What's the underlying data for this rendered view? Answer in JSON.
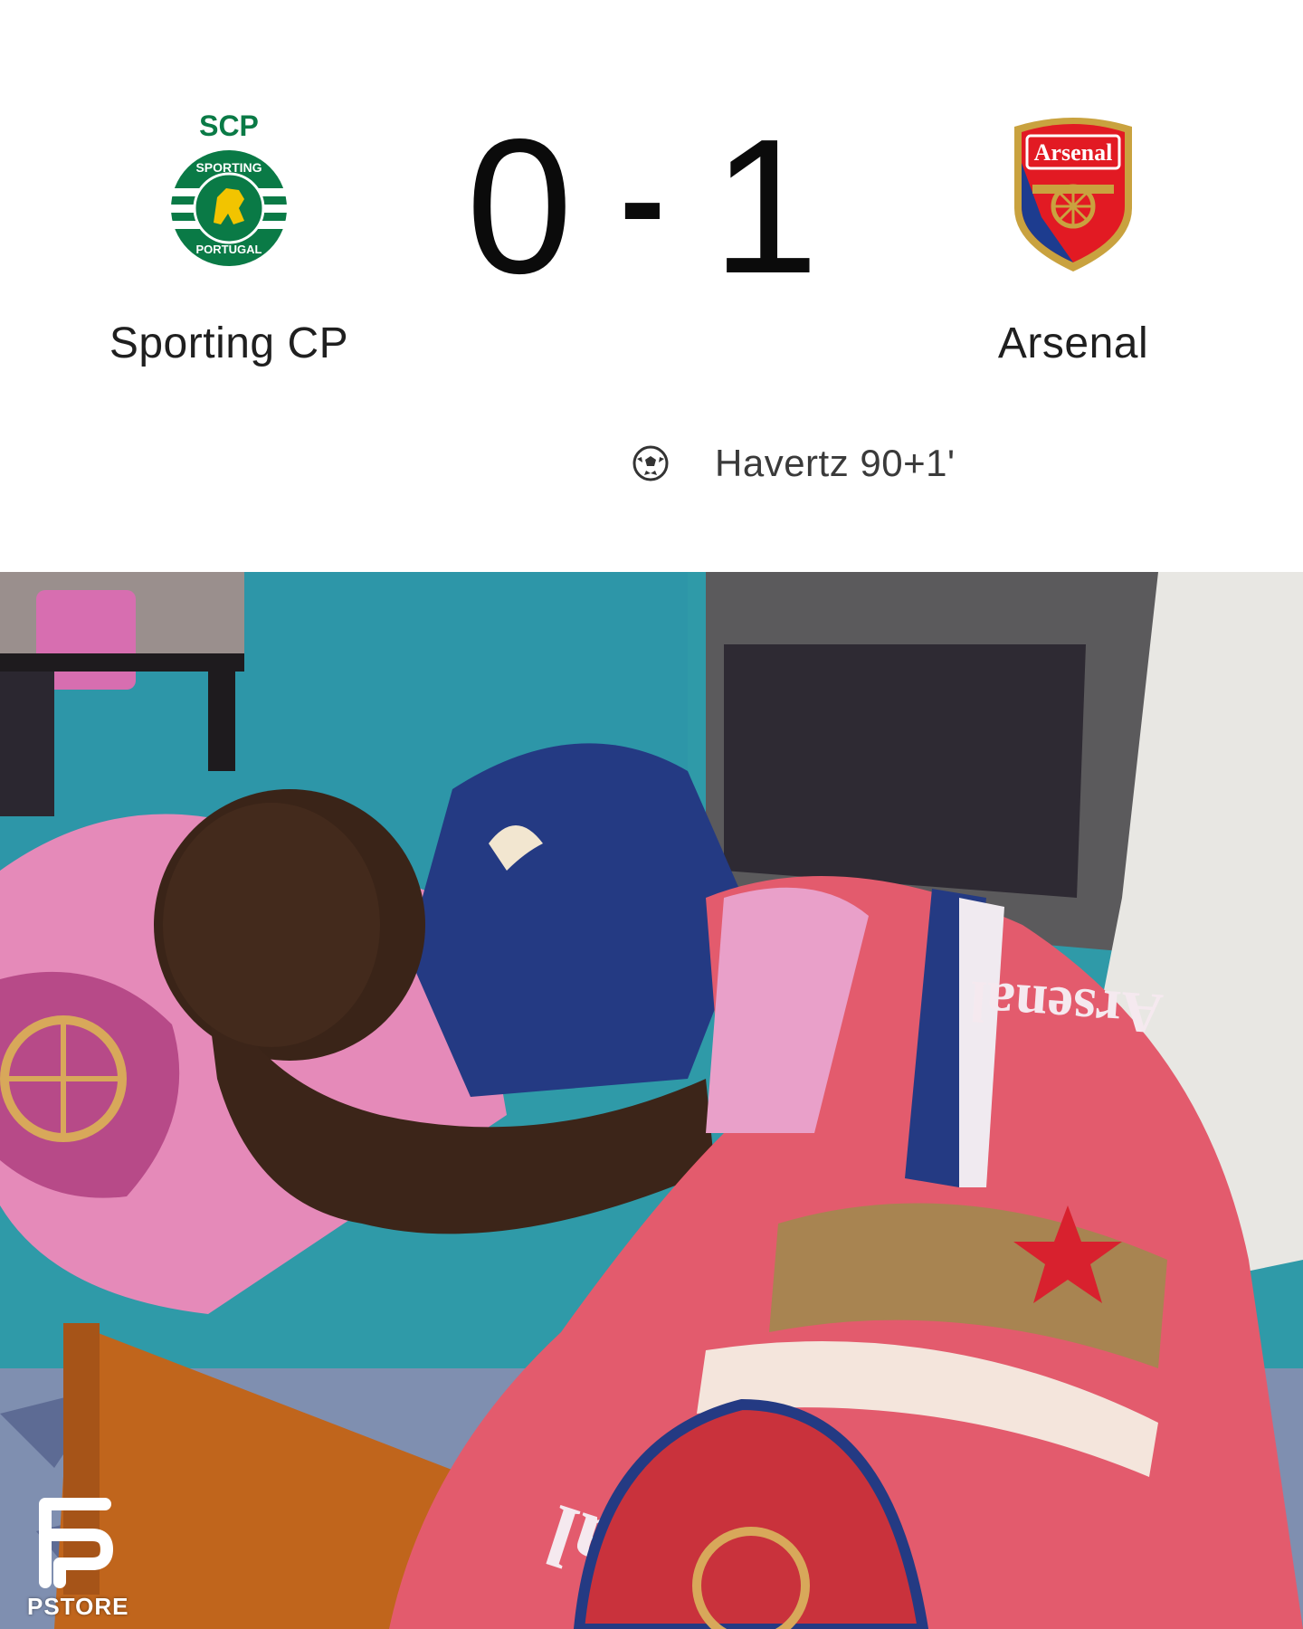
{
  "match": {
    "home_team": "Sporting CP",
    "away_team": "Arsenal",
    "home_score": "0",
    "separator": "-",
    "away_score": "1",
    "scorer": "Havertz 90+1'",
    "home_crest_text_top": "SCP",
    "home_crest_text_ring": "SPORTING",
    "home_crest_text_bottom": "PORTUGAL",
    "away_crest_text": "Arsenal",
    "home_color": "#0a7a46",
    "away_color": "#e21a23"
  },
  "icons": {
    "scorer": "soccer-ball-icon",
    "home_crest": "sporting-cp-crest-icon",
    "away_crest": "arsenal-crest-icon",
    "watermark": "pstore-logo-icon"
  },
  "photo": {
    "subject": "Man sleeping under Arsenal bedding",
    "bedding_text": "Arsenal"
  },
  "watermark": {
    "label": "PSTORE"
  }
}
